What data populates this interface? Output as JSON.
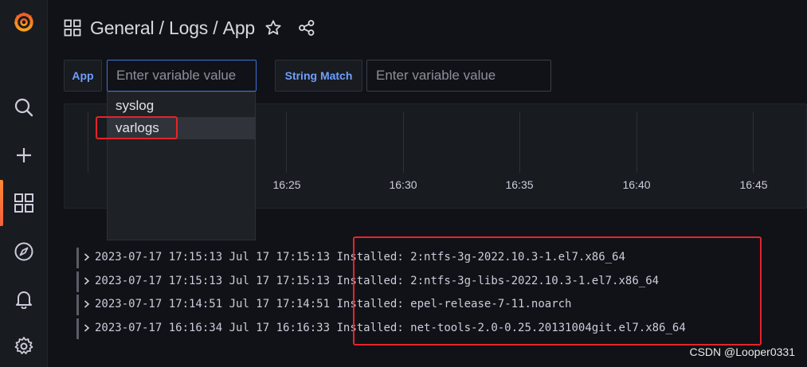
{
  "breadcrumb": {
    "folder": "General",
    "separator1": " / ",
    "section": "Logs",
    "separator2": " / ",
    "dashboard": "App"
  },
  "variables": [
    {
      "label": "App",
      "placeholder": "Enter variable value"
    },
    {
      "label": "String Match",
      "placeholder": "Enter variable value"
    }
  ],
  "dropdown": {
    "options": [
      "syslog",
      "varlogs"
    ],
    "hovered": "varlogs"
  },
  "graph": {
    "ticks": [
      "16:25",
      "16:30",
      "16:35",
      "16:40",
      "16:45"
    ]
  },
  "logs": [
    {
      "timestamp": "2023-07-17 17:15:13",
      "syslog_time": "Jul 17 17:15:13",
      "message": "Installed: 2:ntfs-3g-2022.10.3-1.el7.x86_64"
    },
    {
      "timestamp": "2023-07-17 17:15:13",
      "syslog_time": "Jul 17 17:15:13",
      "message": "Installed: 2:ntfs-3g-libs-2022.10.3-1.el7.x86_64"
    },
    {
      "timestamp": "2023-07-17 17:14:51",
      "syslog_time": "Jul 17 17:14:51",
      "message": "Installed: epel-release-7-11.noarch"
    },
    {
      "timestamp": "2023-07-17 16:16:34",
      "syslog_time": "Jul 17 16:16:33",
      "message": "Installed: net-tools-2.0-0.25.20131004git.el7.x86_64"
    }
  ],
  "watermark": "CSDN @Looper0331",
  "colors": {
    "accent_orange": "#ff8833",
    "link_blue": "#6e9fff",
    "highlight_red": "#e5242a",
    "background": "#111217"
  },
  "icons": {
    "logo": "grafana-logo",
    "sidebar": [
      "search-icon",
      "plus-icon",
      "dashboards-icon",
      "explore-compass-icon",
      "alerting-bell-icon",
      "configuration-gear-icon"
    ],
    "header": [
      "dashboard-grid-icon",
      "star-icon",
      "share-icon"
    ]
  }
}
